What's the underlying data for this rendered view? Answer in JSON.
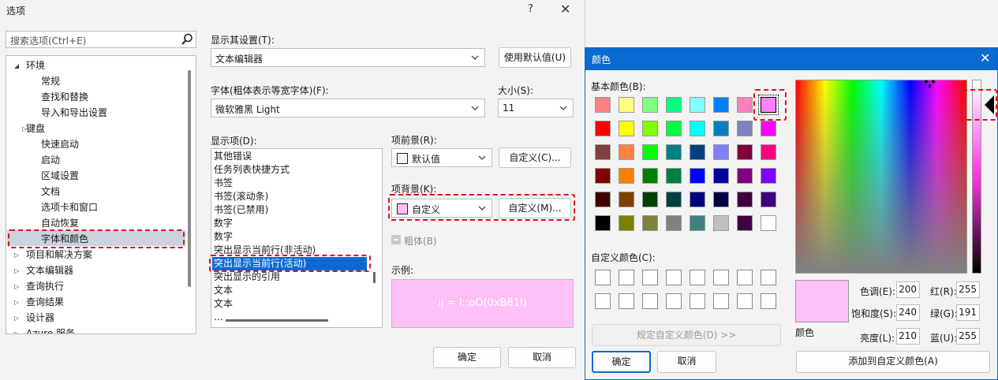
{
  "options_dialog": {
    "title": "选项",
    "help_glyph": "?",
    "close_glyph": "✕",
    "search_placeholder": "搜索选项(Ctrl+E)",
    "tree": [
      {
        "label": "环境",
        "arrow": "◢",
        "indent": 0
      },
      {
        "label": "常规",
        "arrow": "",
        "indent": 2
      },
      {
        "label": "查找和替换",
        "arrow": "",
        "indent": 2
      },
      {
        "label": "导入和导出设置",
        "arrow": "",
        "indent": 2
      },
      {
        "label": "键盘",
        "arrow": "▷",
        "indent": 1
      },
      {
        "label": "快速启动",
        "arrow": "",
        "indent": 2
      },
      {
        "label": "启动",
        "arrow": "",
        "indent": 2
      },
      {
        "label": "区域设置",
        "arrow": "",
        "indent": 2
      },
      {
        "label": "文档",
        "arrow": "",
        "indent": 2
      },
      {
        "label": "选项卡和窗口",
        "arrow": "",
        "indent": 2
      },
      {
        "label": "自动恢复",
        "arrow": "",
        "indent": 2
      },
      {
        "label": "字体和颜色",
        "arrow": "",
        "indent": 2
      },
      {
        "label": "项目和解决方案",
        "arrow": "▷",
        "indent": 0
      },
      {
        "label": "文本编辑器",
        "arrow": "▷",
        "indent": 0
      },
      {
        "label": "查询执行",
        "arrow": "▷",
        "indent": 0
      },
      {
        "label": "查询结果",
        "arrow": "▷",
        "indent": 0
      },
      {
        "label": "设计器",
        "arrow": "▷",
        "indent": 0
      },
      {
        "label": "Azure 服务",
        "arrow": "▷",
        "indent": 0
      }
    ],
    "show_settings_label": "显示其设置(T):",
    "show_settings_value": "文本编辑器",
    "use_defaults_label": "使用默认值(U)",
    "font_label": "字体(粗体表示等宽字体)(F):",
    "font_value": "微软雅黑 Light",
    "size_label": "大小(S):",
    "size_value": "11",
    "display_items_label": "显示项(D):",
    "display_items": [
      "其他错误",
      "任务列表快捷方式",
      "书签",
      "书签(滚动条)",
      "书签(已禁用)",
      "数字",
      "数字",
      "突出显示当前行(非活动)",
      "突出显示当前行(活动)",
      "突出显示的引用",
      "文本",
      "文本",
      "…"
    ],
    "selected_display_item_index": 8,
    "fg_label": "项前景(R):",
    "fg_value": "默认值",
    "fg_custom_label": "自定义(C)...",
    "bg_label": "项背景(K):",
    "bg_value": "自定义",
    "bg_custom_label": "自定义(M)...",
    "bold_label": "粗体(B)",
    "sample_label": "示例:",
    "sample_text": "ij = I::oO(0xB81l)",
    "ok_label": "确定",
    "cancel_label": "取消"
  },
  "color_dialog": {
    "title": "颜色",
    "close_glyph": "✕",
    "basic_colors_label": "基本颜色(B):",
    "basic_colors": [
      "#ff8080",
      "#ffff80",
      "#80ff80",
      "#00ff80",
      "#80ffff",
      "#0080ff",
      "#ff80c0",
      "#ff80ff",
      "#ff0000",
      "#ffff00",
      "#80ff00",
      "#00ff40",
      "#00ffff",
      "#0080c0",
      "#8080c0",
      "#ff00ff",
      "#804040",
      "#ff8040",
      "#00ff00",
      "#008080",
      "#004080",
      "#8080ff",
      "#800040",
      "#ff0080",
      "#800000",
      "#ff8000",
      "#008000",
      "#008040",
      "#0000ff",
      "#0000a0",
      "#800080",
      "#8000ff",
      "#400000",
      "#804000",
      "#004000",
      "#004040",
      "#000080",
      "#000040",
      "#400040",
      "#400080",
      "#000000",
      "#808000",
      "#808040",
      "#808080",
      "#408080",
      "#c0c0c0",
      "#400040",
      "#ffffff"
    ],
    "selected_basic_index": 7,
    "custom_colors_label": "自定义颜色(C):",
    "define_custom_label": "规定自定义颜色(D) >>",
    "ok_label": "确定",
    "cancel_label": "取消",
    "new_color": "#ffbff7",
    "color_label": "颜色",
    "hue_label": "色调(E):",
    "hue_value": "200",
    "sat_label": "饱和度(S):",
    "sat_value": "240",
    "lum_label": "亮度(L):",
    "lum_value": "210",
    "red_label": "红(R):",
    "red_value": "255",
    "green_label": "绿(G):",
    "green_value": "191",
    "blue_label": "蓝(U):",
    "blue_value": "255",
    "add_custom_label": "添加到自定义颜色(A)"
  }
}
